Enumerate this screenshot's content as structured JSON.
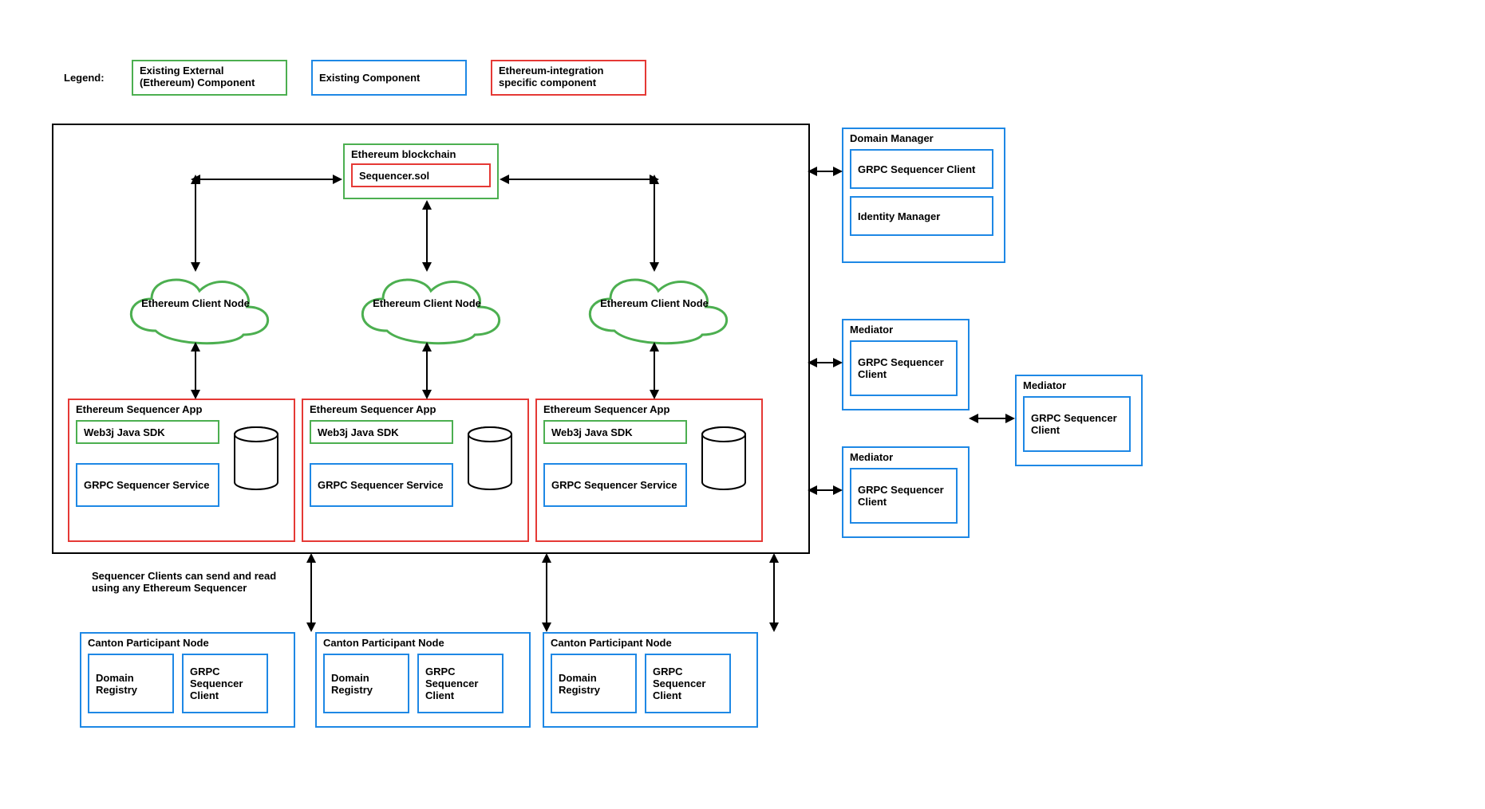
{
  "legend": {
    "label": "Legend:",
    "external": "Existing External (Ethereum) Component",
    "existing": "Existing Component",
    "integration": "Ethereum-integration specific component"
  },
  "blockchain": {
    "title": "Ethereum blockchain",
    "contract": "Sequencer.sol"
  },
  "clientNode": {
    "label": "Ethereum Client Node"
  },
  "sequencerApp": {
    "title": "Ethereum Sequencer App",
    "web3j": "Web3j Java SDK",
    "grpc": "GRPC Sequencer Service"
  },
  "participant": {
    "title": "Canton Participant Node",
    "registry": "Domain Registry",
    "client": "GRPC Sequencer Client"
  },
  "domainManager": {
    "title": "Domain Manager",
    "grpc": "GRPC Sequencer Client",
    "identity": "Identity Manager"
  },
  "mediator": {
    "title": "Mediator",
    "grpc": "GRPC Sequencer Client"
  },
  "note": "Sequencer Clients can send and read using any Ethereum Sequencer"
}
